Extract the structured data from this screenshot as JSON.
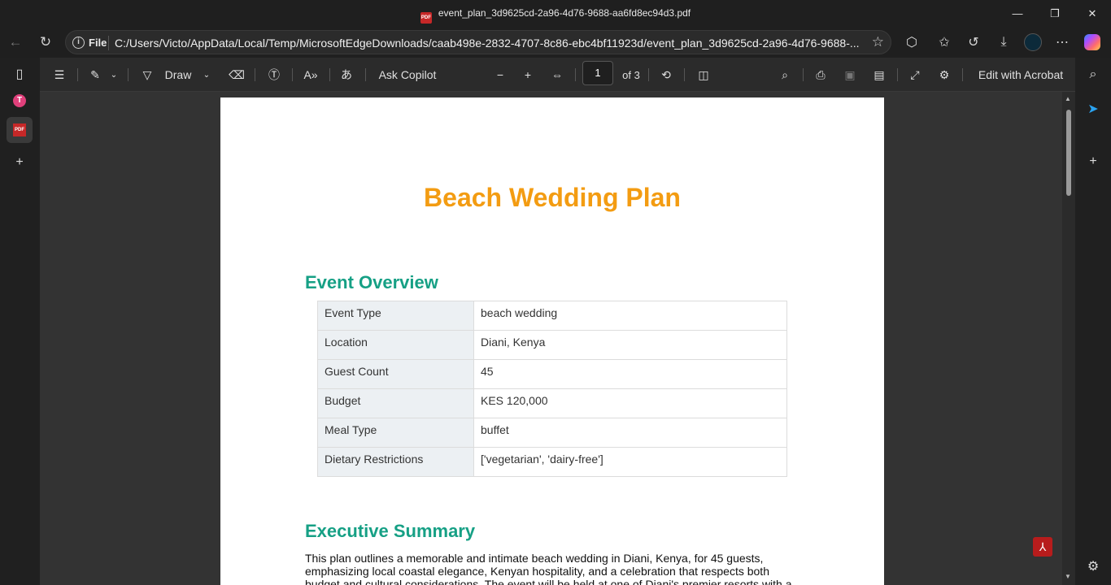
{
  "window": {
    "title": "event_plan_3d9625cd-2a96-4d76-9688-aa6fd8ec94d3.pdf",
    "pdf_badge": "PDF",
    "minimize_glyph": "—",
    "maximize_glyph": "❐",
    "close_glyph": "✕"
  },
  "address_bar": {
    "scheme_label": "File",
    "url": "C:/Users/Victo/AppData/Local/Temp/MicrosoftEdgeDownloads/caab498e-2832-4707-8c86-ebc4bf11923d/event_plan_3d9625cd-2a96-4d76-9688-..."
  },
  "pdf_toolbar": {
    "draw_label": "Draw",
    "ask_copilot_label": "Ask Copilot",
    "page_current": "1",
    "page_total_label": "of 3",
    "edit_acrobat_label": "Edit with Acrobat"
  },
  "document": {
    "title": "Beach Wedding Plan",
    "overview_heading": "Event Overview",
    "overview_rows": [
      {
        "key": "Event Type",
        "value": "beach wedding"
      },
      {
        "key": "Location",
        "value": "Diani, Kenya"
      },
      {
        "key": "Guest Count",
        "value": "45"
      },
      {
        "key": "Budget",
        "value": "KES 120,000"
      },
      {
        "key": "Meal Type",
        "value": "buffet"
      },
      {
        "key": "Dietary Restrictions",
        "value": "['vegetarian', 'dairy-free']"
      }
    ],
    "summary_heading": "Executive Summary",
    "summary_text": "This plan outlines a memorable and intimate beach wedding in Diani, Kenya, for 45 guests, emphasizing local coastal elegance, Kenyan hospitality, and a celebration that respects both budget and cultural considerations. The event will be held at one of Diani's premier resorts with a relaxed yet"
  },
  "colors": {
    "title_color": "#f39c12",
    "heading_color": "#16a085"
  }
}
